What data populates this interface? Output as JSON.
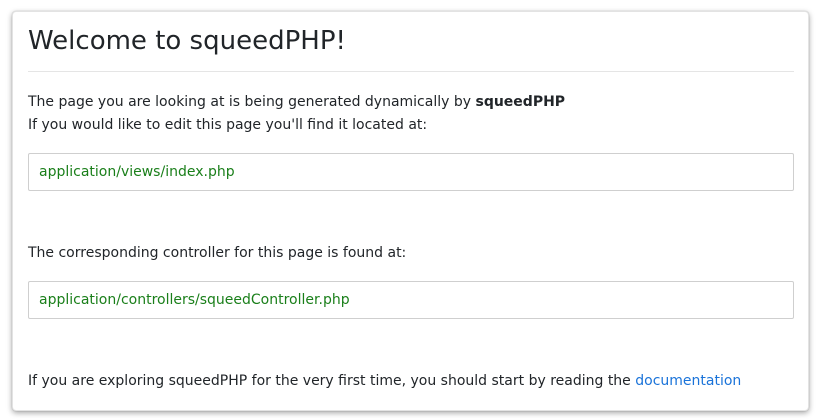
{
  "title": "Welcome to squeedPHP!",
  "intro": {
    "line1_prefix": "The page you are looking at is being generated dynamically by ",
    "line1_bold": "squeedPHP",
    "line2": "If you would like to edit this page you'll find it located at:"
  },
  "view_path": "application/views/index.php",
  "controller": {
    "text": "The corresponding controller for this page is found at:",
    "path": "application/controllers/squeedController.php"
  },
  "footer": {
    "text": "If you are exploring squeedPHP for the very first time, you should start by reading the ",
    "link_label": "documentation"
  },
  "colors": {
    "code_text": "#1a7f1a",
    "link": "#1a73d9",
    "border": "#cfcfcf"
  }
}
